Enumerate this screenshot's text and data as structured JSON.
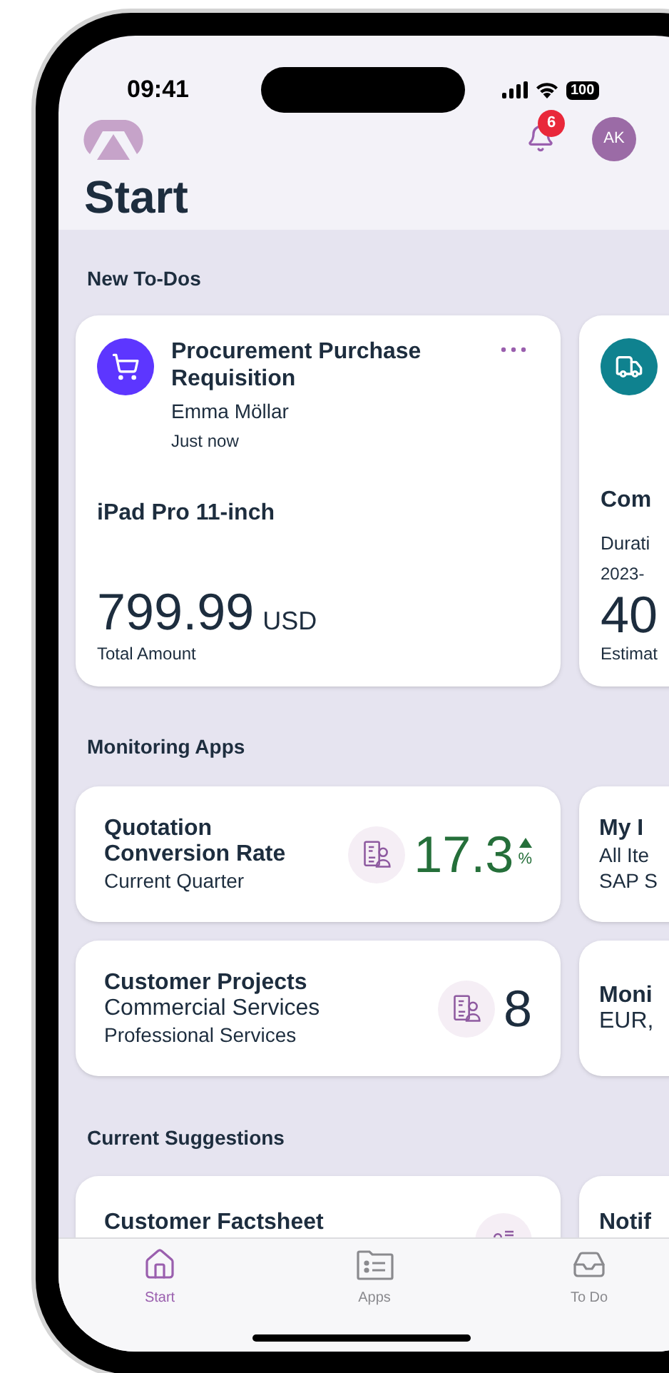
{
  "status_bar": {
    "time": "09:41",
    "battery": "100"
  },
  "header": {
    "notification_count": "6",
    "avatar_initials": "AK",
    "title": "Start"
  },
  "todos": {
    "title": "New To-Dos",
    "cards": [
      {
        "color": "#5d36ff",
        "title": "Procurement Purchase Requisition",
        "author": "Emma Möllar",
        "time": "Just now",
        "item": "iPad Pro 11-inch",
        "amount": "799.99",
        "currency": "USD",
        "amount_label": "Total Amount"
      },
      {
        "color": "#0f828f",
        "item": "Com",
        "detail": "Durati",
        "date": "2023-",
        "amount": "40",
        "amount_label": "Estimat"
      }
    ]
  },
  "monitoring": {
    "title": "Monitoring Apps",
    "rows": [
      [
        {
          "title": "Quotation Conversion Rate",
          "lines": [
            "Current Quarter"
          ],
          "value": "17.3",
          "unit": "%",
          "trend_up": true,
          "kind": "positive"
        },
        {
          "title": "My I",
          "lines": [
            "All Ite",
            "SAP S"
          ]
        }
      ],
      [
        {
          "title": "Customer Projects",
          "lines": [
            "Commercial Services",
            "Professional Services"
          ],
          "value": "8",
          "kind": "neutral"
        },
        {
          "title": "Moni",
          "lines": [
            "EUR,"
          ]
        }
      ]
    ]
  },
  "suggestions": {
    "title": "Current Suggestions",
    "cards": [
      {
        "title": "Customer Factsheet"
      },
      {
        "title": "Notif"
      }
    ]
  },
  "tabs": [
    {
      "label": "Start",
      "selected": true
    },
    {
      "label": "Apps",
      "selected": false
    },
    {
      "label": "To Do",
      "selected": false
    }
  ]
}
